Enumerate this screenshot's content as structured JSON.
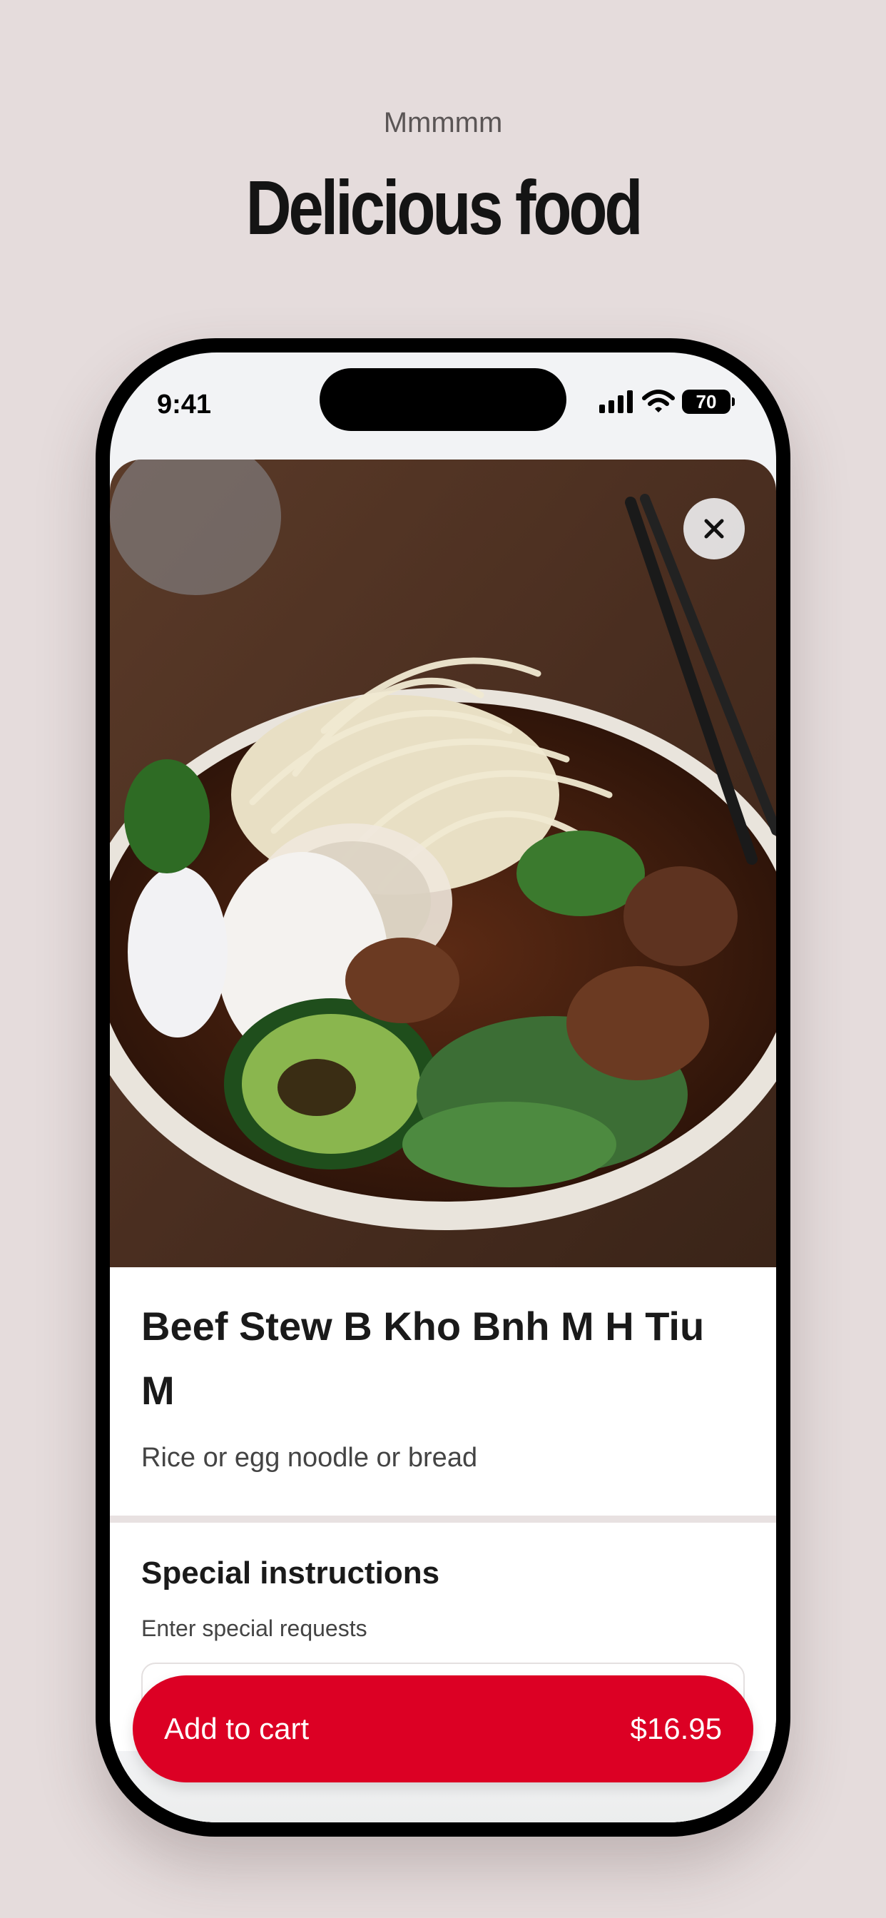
{
  "promo": {
    "subtitle": "Mmmmm",
    "title": "Delicious food"
  },
  "status_bar": {
    "time": "9:41",
    "battery": "70"
  },
  "item": {
    "image_alt": "Bowl of beef stew with bean sprouts, jalapeño slices, basil and chopsticks",
    "title": "Beef Stew B Kho Bnh M H Tiu M",
    "description": "Rice or egg noodle or bread"
  },
  "instructions": {
    "title": "Special instructions",
    "hint": "Enter special requests"
  },
  "cart": {
    "label": "Add to cart",
    "price": "$16.95"
  },
  "colors": {
    "background": "#e5dcdc",
    "accent": "#dc0024"
  },
  "icons": [
    "close-icon",
    "signal-icon",
    "wifi-icon",
    "battery-icon"
  ]
}
